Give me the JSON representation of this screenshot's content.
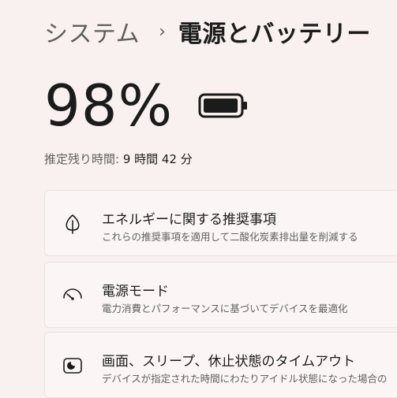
{
  "header": {
    "parent": "システム",
    "separator": "›",
    "current": "電源とバッテリー"
  },
  "battery": {
    "percent_text": "98%",
    "level": 0.98,
    "estimate_label": "推定残り時間: ",
    "estimate_value": "9 時間 42 分"
  },
  "cards": [
    {
      "icon": "leaf-icon",
      "title": "エネルギーに関する推奨事項",
      "description": "これらの推奨事項を適用して二酸化炭素排出量を削減する"
    },
    {
      "icon": "gauge-icon",
      "title": "電源モード",
      "description": "電力消費とパフォーマンスに基づいてデバイスを最適化"
    },
    {
      "icon": "screen-sleep-icon",
      "title": "画面、スリープ、休止状態のタイムアウト",
      "description": "デバイスが指定された時間にわたりアイドル状態になった場合の"
    }
  ]
}
